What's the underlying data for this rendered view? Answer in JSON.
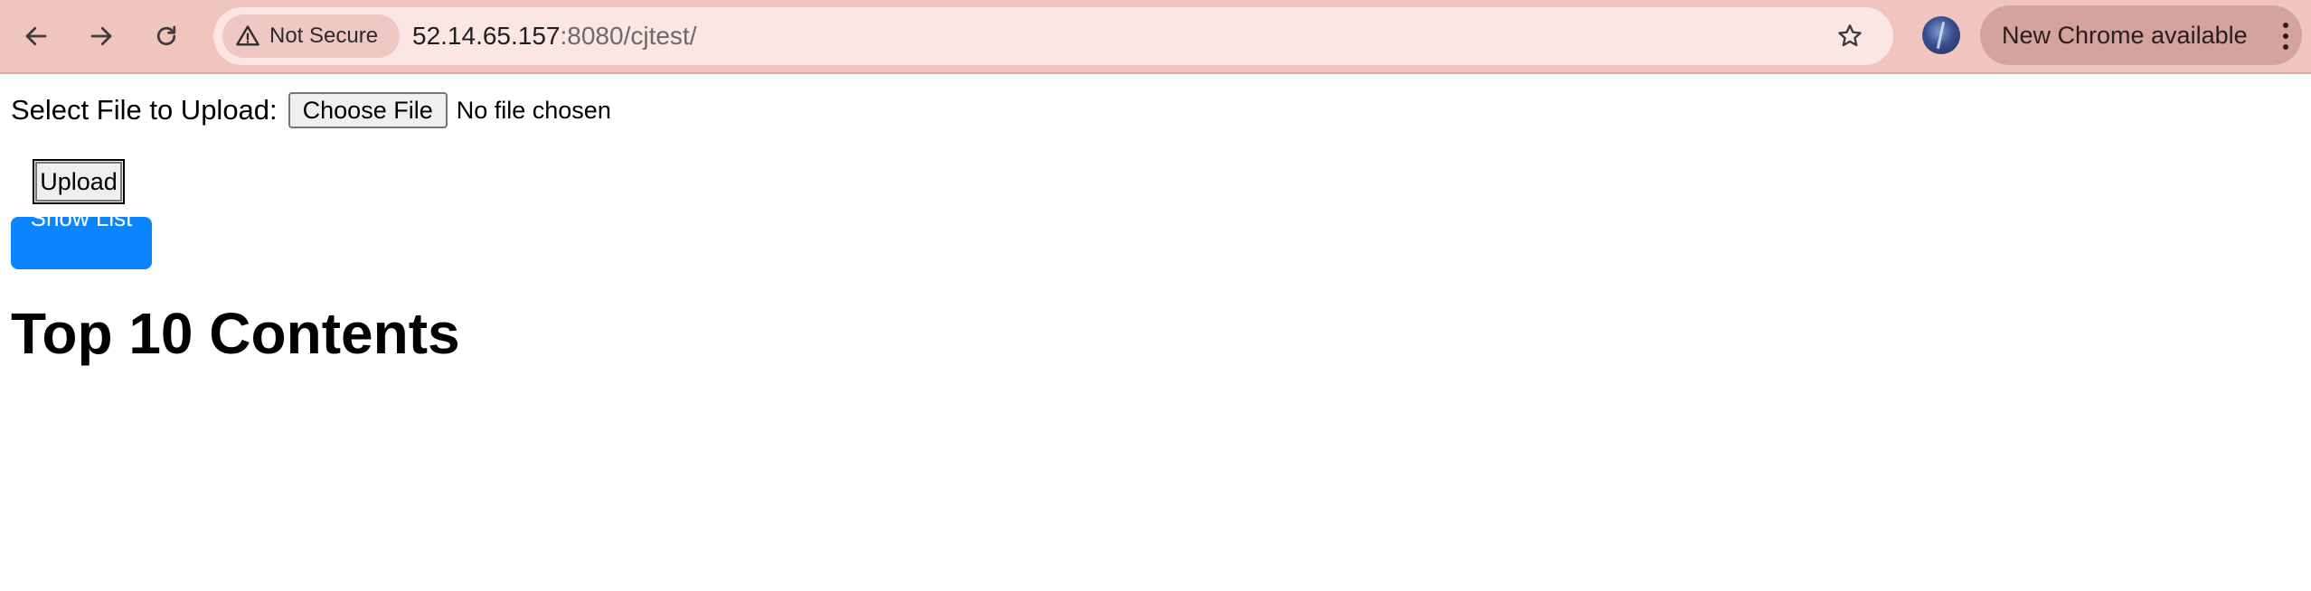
{
  "browser": {
    "security_label": "Not Secure",
    "url_host": "52.14.65.157",
    "url_rest": ":8080/cjtest/",
    "update_label": "New Chrome available",
    "icons": {
      "back": "back-arrow-icon",
      "forward": "forward-arrow-icon",
      "reload": "reload-icon",
      "warning": "warning-triangle-icon",
      "bookmark": "star-icon",
      "menu": "kebab-menu-icon"
    },
    "colors": {
      "toolbar": "#f0c4bf",
      "omnibox": "#fbe6e4",
      "update_chip": "#d4a39d"
    }
  },
  "page": {
    "file_label": "Select File to Upload:",
    "choose_file_label": "Choose File",
    "no_file_text": "No file chosen",
    "upload_label": "Upload",
    "show_list_label": "Show List",
    "heading": "Top 10 Contents",
    "colors": {
      "show_list_button": "#0a84ff"
    }
  }
}
